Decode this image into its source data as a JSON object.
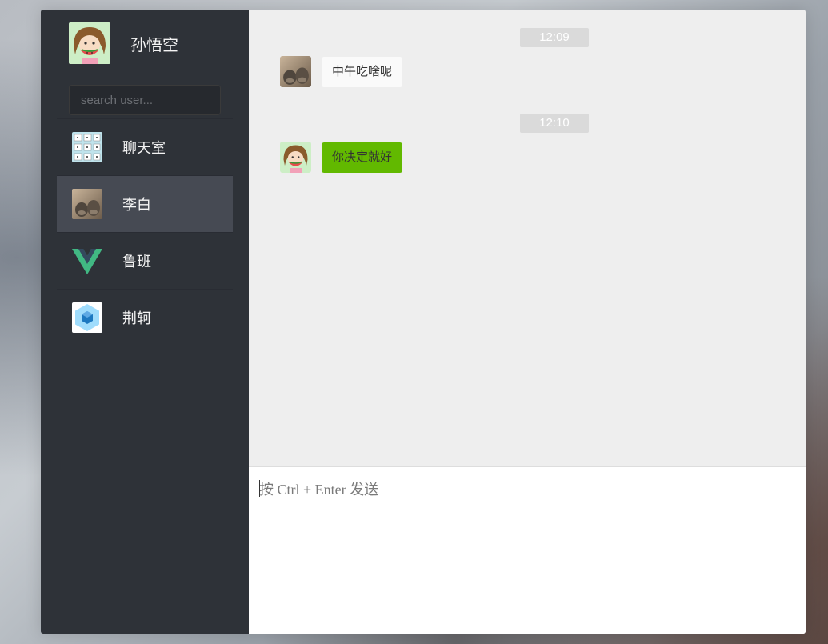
{
  "profile": {
    "username": "孙悟空",
    "avatar_icon": "girl-watermelon-avatar"
  },
  "search": {
    "placeholder": "search user..."
  },
  "users": [
    {
      "name": "聊天室",
      "icon": "stickers-avatar",
      "active": false
    },
    {
      "name": "李白",
      "icon": "cat-paws-avatar",
      "active": true
    },
    {
      "name": "鲁班",
      "icon": "vue-logo-avatar",
      "active": false
    },
    {
      "name": "荆轲",
      "icon": "webpack-cube-avatar",
      "active": false
    }
  ],
  "messages": [
    {
      "time": "12:09",
      "text": "中午吃啥呢",
      "self": false
    },
    {
      "time": "12:10",
      "text": "你决定就好",
      "self": true
    }
  ],
  "composer": {
    "placeholder": "按 Ctrl + Enter 发送"
  },
  "colors": {
    "sidebar_bg": "#2e3238",
    "active_item_bg": "#464a53",
    "chat_bg": "#eeeeee",
    "self_bubble": "#62b900",
    "other_bubble": "#fafafa"
  }
}
